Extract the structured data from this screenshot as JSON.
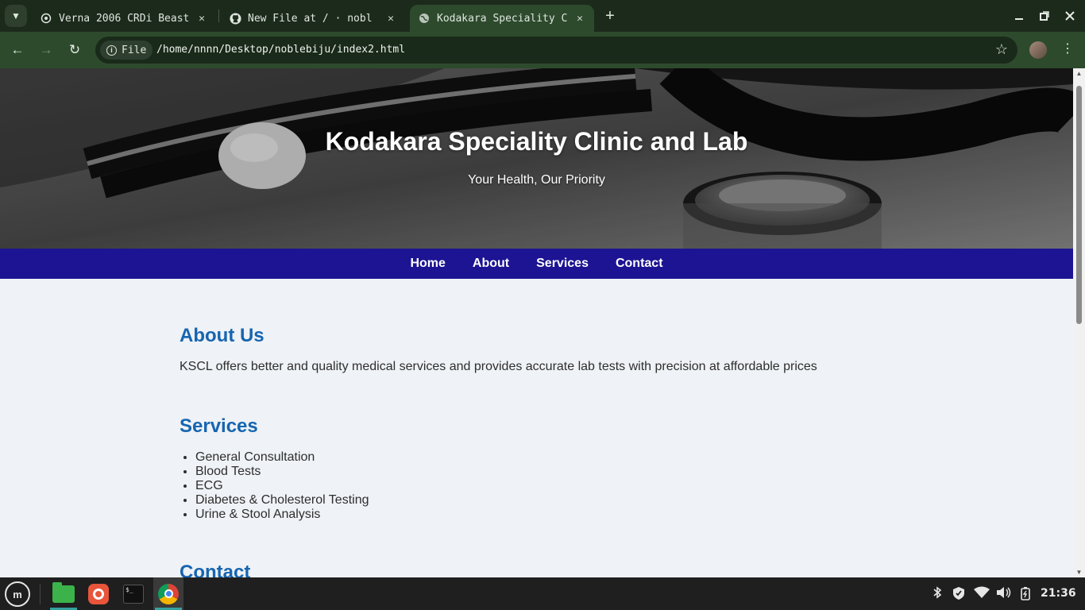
{
  "browser": {
    "tabs": [
      {
        "title": "Verna 2006 CRDi Beast",
        "favicon": "openai-icon",
        "active": false
      },
      {
        "title": "New File at / · nobl",
        "favicon": "github-icon",
        "active": false
      },
      {
        "title": "Kodakara Speciality C",
        "favicon": "globe-icon",
        "active": true
      }
    ],
    "new_tab": "+",
    "address_chip": "File",
    "url": "/home/nnnn/Desktop/noblebiju/index2.html"
  },
  "site": {
    "title": "Kodakara Speciality Clinic and Lab",
    "tagline": "Your Health, Our Priority",
    "nav": [
      "Home",
      "About",
      "Services",
      "Contact"
    ],
    "about": {
      "heading": "About Us",
      "text": "KSCL offers better and quality medical services and provides accurate lab tests with precision at affordable prices"
    },
    "services": {
      "heading": "Services",
      "items": [
        "General Consultation",
        "Blood Tests",
        "ECG",
        "Diabetes & Cholesterol Testing",
        "Urine & Stool Analysis"
      ]
    },
    "contact": {
      "heading": "Contact"
    },
    "colors": {
      "nav_bar": "#1c1492",
      "heading": "#1665b0",
      "page_bg": "#eff2f6"
    }
  },
  "taskbar": {
    "apps": [
      "files-icon",
      "firefox-icon",
      "terminal-icon",
      "chrome-icon"
    ],
    "terminal_glyph": "$_",
    "clock": "21:36"
  }
}
